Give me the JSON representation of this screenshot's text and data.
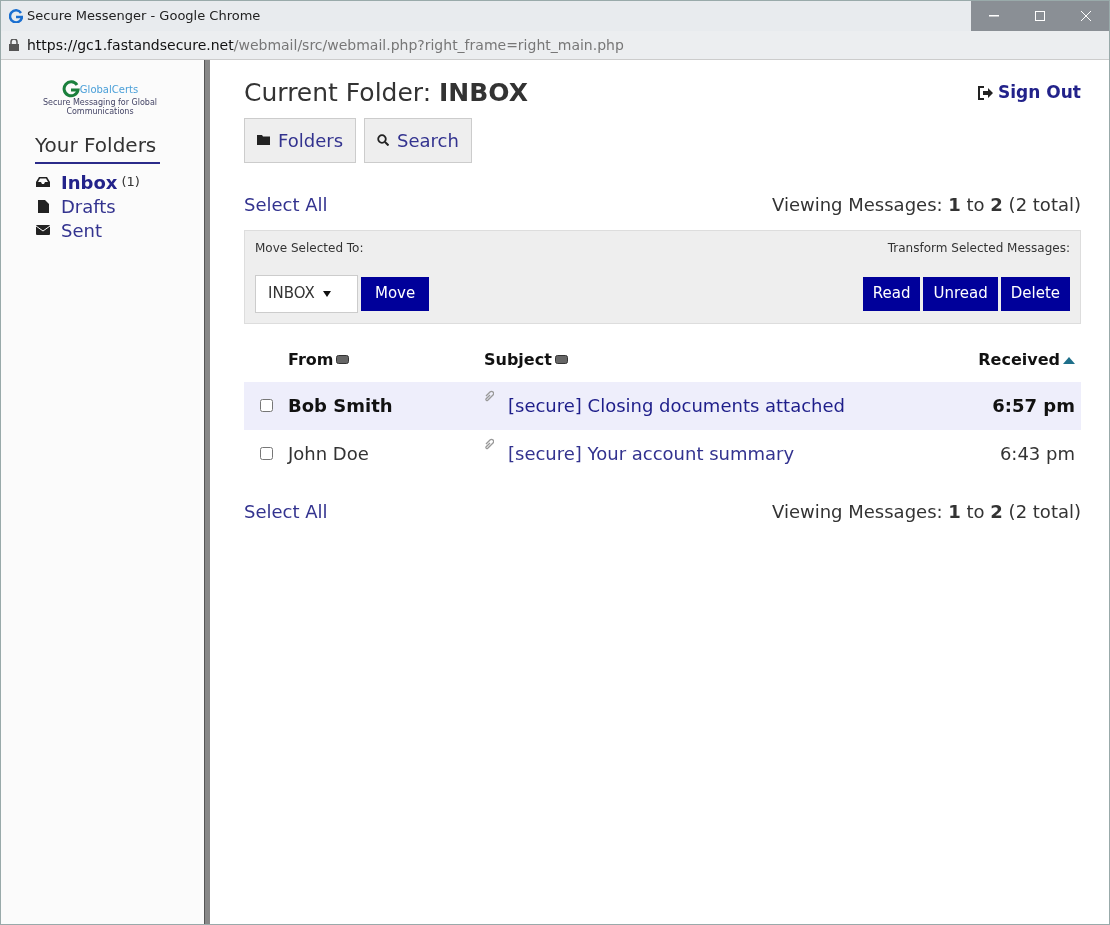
{
  "window": {
    "title": "Secure Messenger - Google Chrome",
    "url_host": "https://gc1.fastandsecure.net",
    "url_path": "/webmail/src/webmail.php?right_frame=right_main.php"
  },
  "logo": {
    "name": "GlobalCerts",
    "tagline": "Secure Messaging for Global Communications"
  },
  "sidebar": {
    "title": "Your Folders",
    "items": [
      {
        "label": "Inbox",
        "count": "(1)",
        "selected": true,
        "kind": "inbox"
      },
      {
        "label": "Drafts",
        "selected": false,
        "kind": "drafts"
      },
      {
        "label": "Sent",
        "selected": false,
        "kind": "sent"
      }
    ]
  },
  "header": {
    "title_prefix": "Current Folder:",
    "folder": "INBOX",
    "sign_out": "Sign Out"
  },
  "tabs": [
    {
      "label": "Folders",
      "kind": "folder"
    },
    {
      "label": "Search",
      "kind": "search"
    }
  ],
  "select_all_top": "Select All",
  "viewing_top": "Viewing Messages: **1** to **2** (2 total)",
  "toolbar": {
    "move_label": "Move Selected To:",
    "transform_label": "Transform Selected Messages:",
    "folder_select": "INBOX",
    "move_button": "Move",
    "actions": [
      "Read",
      "Unread",
      "Delete"
    ]
  },
  "table": {
    "columns": [
      {
        "label": "From",
        "sorted": false
      },
      {
        "label": "Subject",
        "sorted": false
      },
      {
        "label": "Received",
        "sorted": true
      }
    ],
    "rows": [
      {
        "from": "Bob Smith",
        "subject": "[secure] Closing documents attached",
        "received": "6:57 pm",
        "unread": true,
        "checked": false,
        "attachment": true
      },
      {
        "from": "John Doe",
        "subject": "[secure] Your account summary",
        "received": "6:43 pm",
        "unread": false,
        "checked": false,
        "attachment": true
      }
    ]
  },
  "select_all_bottom": "Select All",
  "viewing_bottom": "Viewing Messages: **1** to **2** (2 total)"
}
